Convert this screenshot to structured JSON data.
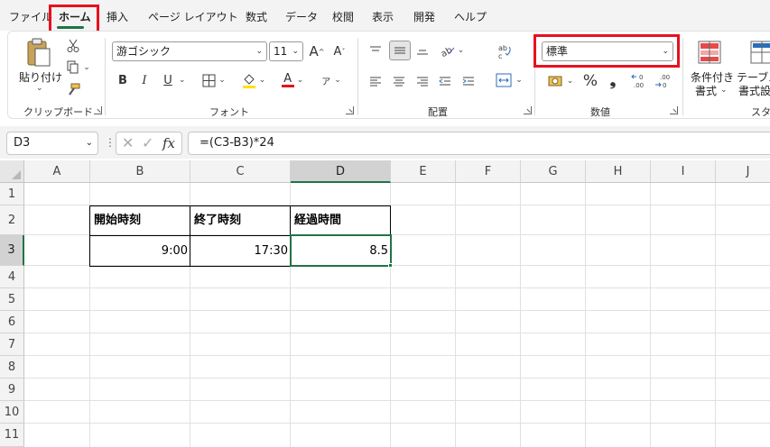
{
  "menu_tabs": [
    "ファイル",
    "ホーム",
    "挿入",
    "ページ レイアウト",
    "数式",
    "データ",
    "校閲",
    "表示",
    "開発",
    "ヘルプ"
  ],
  "ribbon": {
    "clipboard": {
      "paste_label": "貼り付け",
      "group_label": "クリップボード"
    },
    "font": {
      "font_name": "游ゴシック",
      "font_size": "11",
      "grow_glyph": "A",
      "shrink_glyph": "A",
      "bold": "B",
      "italic": "I",
      "underline": "U",
      "font_color_glyph": "A",
      "phonetic_glyph": "ア",
      "group_label": "フォント"
    },
    "alignment": {
      "group_label": "配置"
    },
    "number": {
      "format_value": "標準",
      "percent_glyph": "%",
      "comma_glyph": "❟",
      "group_label": "数値"
    },
    "styles": {
      "conditional_label_1": "条件付き",
      "conditional_label_2": "書式",
      "table_label_1": "テーブル",
      "table_label_2": "書式設",
      "group_label": "スタ"
    }
  },
  "formula_bar": {
    "name_box": "D3",
    "fx_symbol": "fx",
    "formula": "=(C3-B3)*24"
  },
  "sheet": {
    "columns": [
      "A",
      "B",
      "C",
      "D",
      "E",
      "F",
      "G",
      "H",
      "I",
      "J"
    ],
    "rows": [
      "1",
      "2",
      "3",
      "4",
      "5",
      "6",
      "7",
      "8",
      "9",
      "10",
      "11"
    ],
    "headers": {
      "b2": "開始時刻",
      "c2": "終了時刻",
      "d2": "経過時間"
    },
    "values": {
      "b3": "9:00",
      "c3": "17:30",
      "d3": "8.5"
    },
    "selected_cell": "D3"
  },
  "colors": {
    "accent": "#217346",
    "highlight": "#e8101e",
    "font_color_bar": "#e8101e",
    "fill_color_bar": "#ffe100"
  }
}
